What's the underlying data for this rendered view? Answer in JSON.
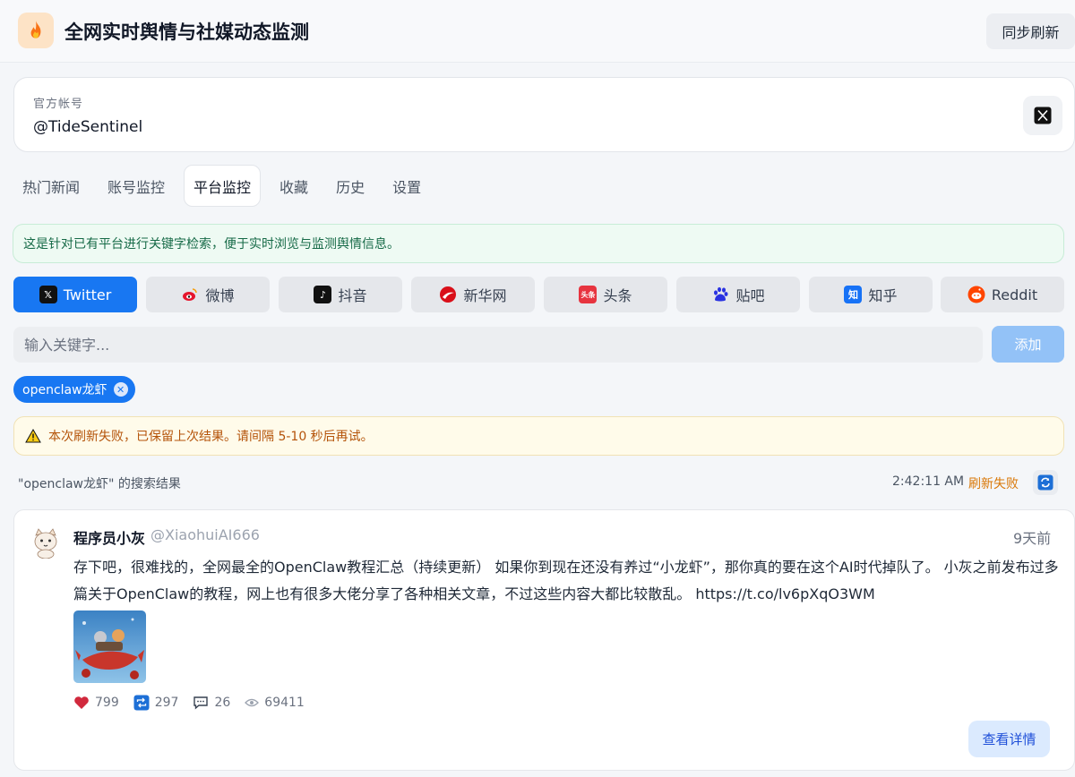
{
  "header": {
    "title": "全网实时舆情与社媒动态监测",
    "sync_label": "同步刷新",
    "logo_icon": "flame-icon"
  },
  "account": {
    "label": "官方帐号",
    "handle": "@TideSentinel",
    "platform_icon": "x-logo-icon"
  },
  "tabs": [
    {
      "label": "热门新闻"
    },
    {
      "label": "账号监控"
    },
    {
      "label": "平台监控",
      "active": true
    },
    {
      "label": "收藏"
    },
    {
      "label": "历史"
    },
    {
      "label": "设置"
    }
  ],
  "info_banner": "这是针对已有平台进行关键字检索，便于实时浏览与监测舆情信息。",
  "platforms": [
    {
      "label": "Twitter",
      "icon": "x-logo-icon",
      "active": true
    },
    {
      "label": "微博",
      "icon": "weibo-icon"
    },
    {
      "label": "抖音",
      "icon": "douyin-icon"
    },
    {
      "label": "新华网",
      "icon": "xinhua-icon"
    },
    {
      "label": "头条",
      "icon": "toutiao-icon"
    },
    {
      "label": "贴吧",
      "icon": "tieba-icon"
    },
    {
      "label": "知乎",
      "icon": "zhihu-icon"
    },
    {
      "label": "Reddit",
      "icon": "reddit-icon"
    }
  ],
  "keyword": {
    "placeholder": "输入关键字...",
    "value": "",
    "add_label": "添加",
    "chips": [
      {
        "label": "openclaw龙虾"
      }
    ]
  },
  "warning": "本次刷新失败，已保留上次结果。请间隔 5-10 秒后再试。",
  "results": {
    "label": "\"openclaw龙虾\" 的搜索结果",
    "time": "2:42:11 AM",
    "status": "刷新失败"
  },
  "post": {
    "author": "程序员小灰",
    "handle": "@XiaohuiAI666",
    "time": "9天前",
    "text": "存下吧，很难找的，全网最全的OpenClaw教程汇总（持续更新） 如果你到现在还没有养过“小龙虾”，那你真的要在这个AI时代掉队了。 小灰之前发布过多篇关于OpenClaw的教程，网上也有很多大佬分享了各种相关文章，不过这些内容大都比较散乱。 https://t.co/lv6pXqO3WM",
    "likes": "799",
    "retweets": "297",
    "replies": "26",
    "views": "69411",
    "detail_label": "查看详情"
  },
  "colors": {
    "accent": "#1877f2",
    "warning": "#d97706",
    "success_text": "#166a47"
  }
}
